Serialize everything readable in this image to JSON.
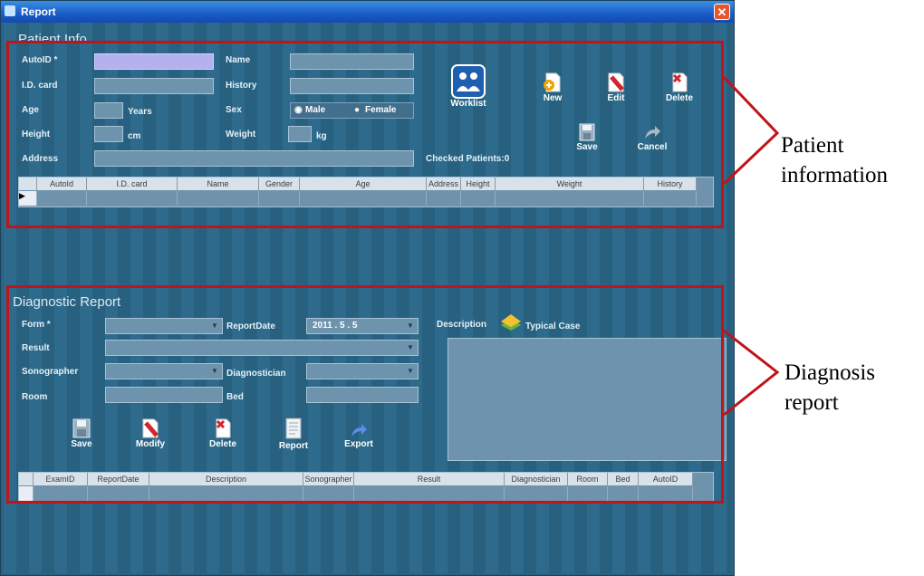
{
  "window": {
    "title": "Report",
    "close_glyph": "✕"
  },
  "patient_info": {
    "group_title": "Patient Info",
    "labels": {
      "autoid": "AutoID *",
      "idcard": "I.D. card",
      "age": "Age",
      "height": "Height",
      "address": "Address",
      "name": "Name",
      "history": "History",
      "sex": "Sex",
      "weight": "Weight",
      "years": "Years",
      "cm": "cm",
      "kg": "kg",
      "checked": "Checked Patients:0"
    },
    "sex_options": [
      "Male",
      "Female"
    ],
    "sex_selected": "Male",
    "toolbar": {
      "worklist": "Worklist",
      "new": "New",
      "edit": "Edit",
      "delete": "Delete",
      "save": "Save",
      "cancel": "Cancel"
    },
    "grid_columns": [
      "AutoId",
      "I.D. card",
      "Name",
      "Gender",
      "Age",
      "Address",
      "Height",
      "Weight",
      "History"
    ]
  },
  "diagnostic_report": {
    "group_title": "Diagnostic Report",
    "labels": {
      "form": "Form *",
      "result": "Result",
      "sonographer": "Sonographer",
      "room": "Room",
      "report_date": "ReportDate",
      "diagnostician": "Diagnostician",
      "bed": "Bed",
      "description": "Description",
      "typical_case": "Typical Case"
    },
    "report_date_value": "2011 . 5 . 5",
    "toolbar": {
      "save": "Save",
      "modify": "Modify",
      "delete": "Delete",
      "report": "Report",
      "export": "Export"
    },
    "grid_columns": [
      "ExamID",
      "ReportDate",
      "Description",
      "Sonographer",
      "Result",
      "Diagnostician",
      "Room",
      "Bed",
      "AutoID"
    ]
  },
  "annotations": {
    "patient_information": [
      "Patient",
      "information"
    ],
    "diagnosis_report": [
      "Diagnosis",
      "report"
    ],
    "color": "#c0141a"
  },
  "colors": {
    "window_bg": "#2b6385",
    "title_bar": "#1a5bc8",
    "field": "#6d93ad",
    "selected_field": "#b5b0ee"
  }
}
